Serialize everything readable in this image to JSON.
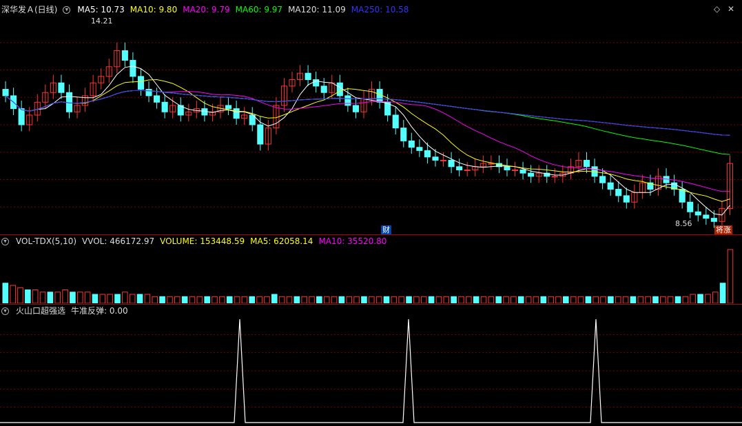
{
  "main_legend": {
    "title": "深华发Ａ(日线)",
    "ma_labels": [
      {
        "text": "MA5: 10.73",
        "color": "#ffffff"
      },
      {
        "text": "MA10: 9.80",
        "color": "#ffff00"
      },
      {
        "text": "MA20: 9.79",
        "color": "#ff00ff"
      },
      {
        "text": "MA60: 9.97",
        "color": "#00ff00"
      },
      {
        "text": "MA120: 11.09",
        "color": "#dddddd"
      },
      {
        "text": "MA250: 10.58",
        "color": "#3333ff"
      }
    ]
  },
  "volume_legend": {
    "title": "VOL-TDX(5,10)",
    "items": [
      {
        "text": "VVOL: 466172.97",
        "color": "#dddddd"
      },
      {
        "text": "VOLUME: 153448.59",
        "color": "#ffff00"
      },
      {
        "text": "MA5: 62058.14",
        "color": "#ffff00"
      },
      {
        "text": "MA10: 35520.80",
        "color": "#ff00ff"
      }
    ]
  },
  "indicator_legend": {
    "title": "火山口超强选",
    "items": [
      {
        "text": "牛准反弹: 0.00",
        "color": "#dddddd"
      }
    ]
  },
  "annotations": {
    "high_label": "14.21",
    "low_label": "8.56",
    "finance_tag": "财",
    "limit_tag": "将涨"
  },
  "window_buttons": {
    "restore": "◇",
    "close": "✕"
  },
  "colors": {
    "up": "#ff3333",
    "down": "#54ffff",
    "grid": "#7a0000",
    "divider": "#aa0000"
  },
  "chart_data": [
    {
      "type": "candlestick",
      "title": "深华发Ａ(日线)",
      "y_range": [
        8.2,
        15.0
      ],
      "high": 14.21,
      "low": 8.56,
      "close_series": [
        12.5,
        12.1,
        11.6,
        11.9,
        12.3,
        12.6,
        12.9,
        12.6,
        12.0,
        12.2,
        12.5,
        12.9,
        13.1,
        13.4,
        13.9,
        13.6,
        13.1,
        12.7,
        12.5,
        12.3,
        12.0,
        12.2,
        11.9,
        12.0,
        12.1,
        11.9,
        12.0,
        12.2,
        12.1,
        11.8,
        11.9,
        11.6,
        11.0,
        11.5,
        12.2,
        12.8,
        13.0,
        13.2,
        13.0,
        12.8,
        12.6,
        12.9,
        12.5,
        12.2,
        12.0,
        12.4,
        12.7,
        12.3,
        11.9,
        11.5,
        11.1,
        10.9,
        10.8,
        10.6,
        10.5,
        10.5,
        10.3,
        10.2,
        10.2,
        10.3,
        10.4,
        10.4,
        10.3,
        10.2,
        10.2,
        10.1,
        10.0,
        10.1,
        10.0,
        10.0,
        10.1,
        10.3,
        10.5,
        10.3,
        10.0,
        9.8,
        9.6,
        9.4,
        9.2,
        9.5,
        9.8,
        9.6,
        10.0,
        9.8,
        9.6,
        9.2,
        8.9,
        8.8,
        8.7,
        8.6,
        9.0,
        10.4
      ]
    },
    {
      "type": "bar",
      "title": "VOL-TDX(5,10)",
      "values": [
        9,
        8,
        7,
        6,
        6,
        5,
        5,
        5,
        6,
        5,
        5,
        5,
        4,
        4,
        4,
        4,
        5,
        4,
        4,
        4,
        3,
        3,
        3,
        3,
        3,
        3,
        3,
        3,
        3,
        3,
        3,
        3,
        3,
        3,
        3,
        3,
        4,
        3,
        3,
        3,
        3,
        3,
        3,
        3,
        3,
        3,
        3,
        3,
        3,
        3,
        3,
        3,
        3,
        3,
        3,
        3,
        3,
        3,
        3,
        3,
        3,
        3,
        3,
        3,
        3,
        3,
        3,
        3,
        3,
        3,
        3,
        3,
        3,
        3,
        3,
        3,
        3,
        3,
        3,
        3,
        3,
        3,
        3,
        3,
        3,
        3,
        3,
        3,
        3,
        3,
        3,
        3,
        4,
        4,
        4,
        5,
        9,
        24
      ]
    },
    {
      "type": "line",
      "title": "火山口超强选",
      "series": [
        {
          "name": "牛准反弹",
          "spikes_x": [
            348,
            593,
            865
          ],
          "peak": 1,
          "base": 0
        }
      ]
    }
  ]
}
